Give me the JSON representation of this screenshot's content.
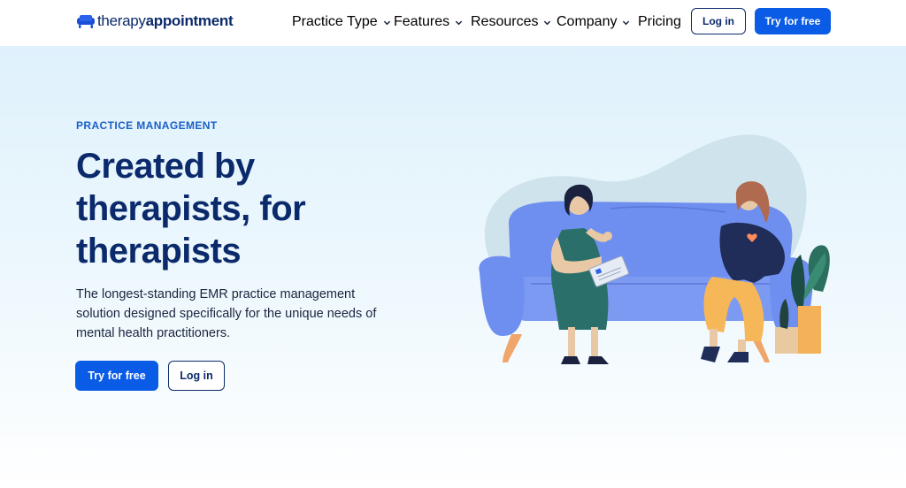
{
  "header": {
    "logo": {
      "text_light": "therapy",
      "text_bold": "appointment",
      "icon": "couch-icon"
    },
    "nav": [
      {
        "label": "Practice Type",
        "has_dropdown": true
      },
      {
        "label": "Features",
        "has_dropdown": true
      },
      {
        "label": "Resources",
        "has_dropdown": true
      },
      {
        "label": "Company",
        "has_dropdown": true
      },
      {
        "label": "Pricing",
        "has_dropdown": false
      }
    ],
    "login_label": "Log in",
    "try_label": "Try for free"
  },
  "hero": {
    "eyebrow": "PRACTICE MANAGEMENT",
    "headline_lines": [
      "Created by",
      "therapists, for",
      "therapists"
    ],
    "subtext": "The longest-standing EMR practice management solution designed specifically for the unique needs of mental health practitioners.",
    "try_label": "Try for free",
    "login_label": "Log in",
    "illustration": "therapy-session-illustration"
  },
  "colors": {
    "brand_navy": "#0b2a6b",
    "brand_blue": "#0a5ce6",
    "eyebrow_blue": "#1a5fc8",
    "hero_bg_top": "#dff1fc",
    "couch": "#6e8ff0"
  }
}
